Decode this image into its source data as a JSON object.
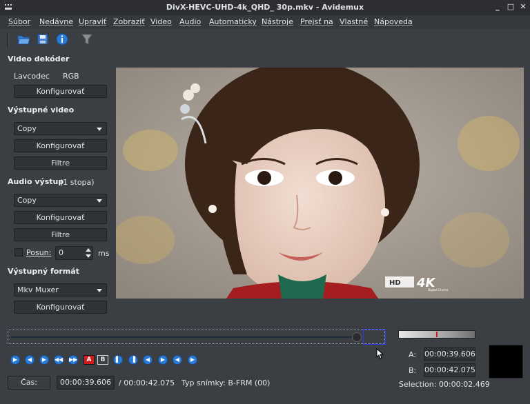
{
  "window": {
    "title": "DivX-HEVC-UHD-4k_QHD_            30p.mkv - Avidemux",
    "minimize": "_",
    "maximize": "□",
    "close": "✕"
  },
  "menu": [
    "Súbor",
    "Nedávne",
    "Upraviť",
    "Zobraziť",
    "Video",
    "Audio",
    "Automaticky",
    "Nástroje",
    "Prejsť na",
    "Vlastné",
    "Nápoveda"
  ],
  "toolbar": {
    "icons": [
      "open-icon",
      "save-icon",
      "info-icon",
      "filter-icon"
    ]
  },
  "left": {
    "video_decoder": {
      "heading": "Video dekóder",
      "codec": "Lavcodec",
      "format": "RGB",
      "config": "Konfigurovať"
    },
    "video_output": {
      "heading": "Výstupné video",
      "codec": "Copy",
      "config": "Konfigurovať",
      "filters": "Filtre"
    },
    "audio_output": {
      "heading": "Audio výstup",
      "tracks": "(1 stopa)",
      "codec": "Copy",
      "config": "Konfigurovať",
      "filters": "Filtre",
      "shift_label": "Posun:",
      "shift_value": "0",
      "shift_unit": "ms"
    },
    "output_format": {
      "heading": "Výstupný formát",
      "muxer": "Mkv Muxer",
      "config": "Konfigurovať"
    }
  },
  "video": {
    "watermark": "4K",
    "watermark_sub": "Digital Cinema",
    "hd_badge": "HD"
  },
  "playback": {
    "selection_a_label": "A:",
    "selection_a": "00:00:39.606",
    "selection_b_label": "B:",
    "selection_b": "00:00:42.075",
    "selection": "Selection: 00:00:02.469",
    "seek_position": 0.94
  },
  "statusbar": {
    "time_button": "Čas:",
    "current_time": "00:00:39.606",
    "total_time": "/ 00:00:42.075",
    "frame_type": "Typ snímky:  B-FRM (00)"
  },
  "colors": {
    "accent": "#2a7ad8",
    "selection_box": "#2b3cf0",
    "marker": "#d11c1c"
  }
}
